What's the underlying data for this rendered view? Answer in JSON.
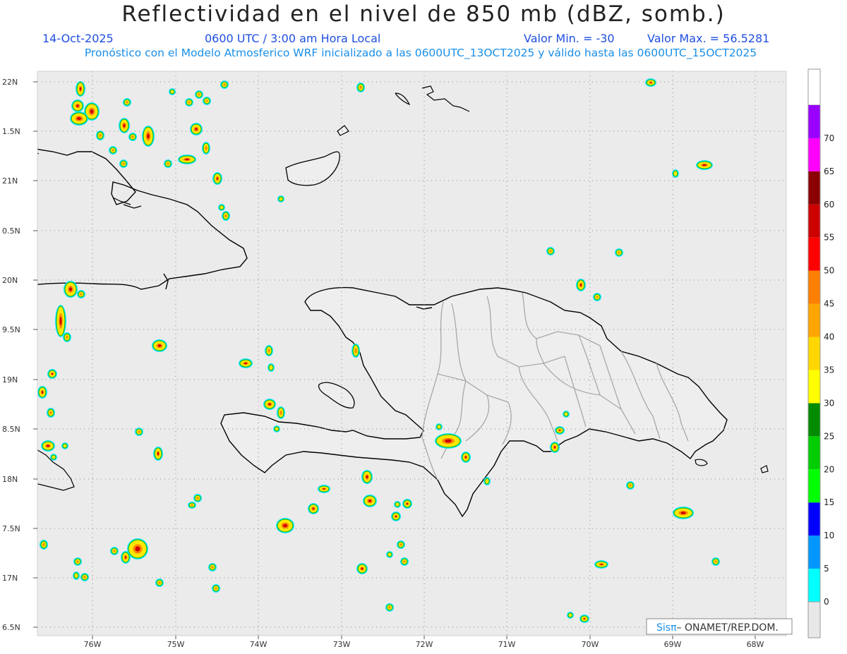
{
  "header": {
    "title": "Reflectividad en el nivel de 850 mb (dBZ, somb.)",
    "date": "14-Oct-2025",
    "time": "0600 UTC / 3:00 am Hora Local",
    "min_label": "Valor Min. = -30",
    "max_label": "Valor Max. = 56.5281",
    "forecast": "Pronóstico con el Modelo Atmosferico WRF inicializado a las 0600UTC_13OCT2025 y válido hasta las  0600UTC_15OCT2025"
  },
  "axes": {
    "lat_labels": [
      "22N",
      "1.5N",
      "21N",
      "0.5N",
      "20N",
      "9.5N",
      "19N",
      "8.5N",
      "18N",
      "7.5N",
      "17N",
      "6.5N"
    ],
    "lon_labels": [
      "76W",
      "75W",
      "74W",
      "73W",
      "72W",
      "71W",
      "70W",
      "69W",
      "68W"
    ],
    "lat_range": [
      16.5,
      22
    ],
    "lon_range": [
      -76.65,
      -67.65
    ]
  },
  "colorbar": {
    "labels": [
      "0",
      "5",
      "10",
      "15",
      "20",
      "25",
      "30",
      "35",
      "40",
      "45",
      "50",
      "55",
      "60",
      "65",
      "70"
    ],
    "colors": [
      "#00ffff",
      "#0096ff",
      "#0000ff",
      "#00ff00",
      "#00cd00",
      "#008b00",
      "#ffff00",
      "#ffd700",
      "#ffa500",
      "#ff7f00",
      "#ff0000",
      "#cd0000",
      "#8b0000",
      "#ff00ff",
      "#9a00ff"
    ],
    "zero_color": "#e8e8e8"
  },
  "credit": {
    "sis": "Sis",
    "pi": "π",
    "rest": "– ONAMET/REP.DOM."
  },
  "colors": {
    "map_background": "#ebebeb",
    "coast": "#000000",
    "provinces": "#a8a8a8",
    "grid": "#777777"
  }
}
